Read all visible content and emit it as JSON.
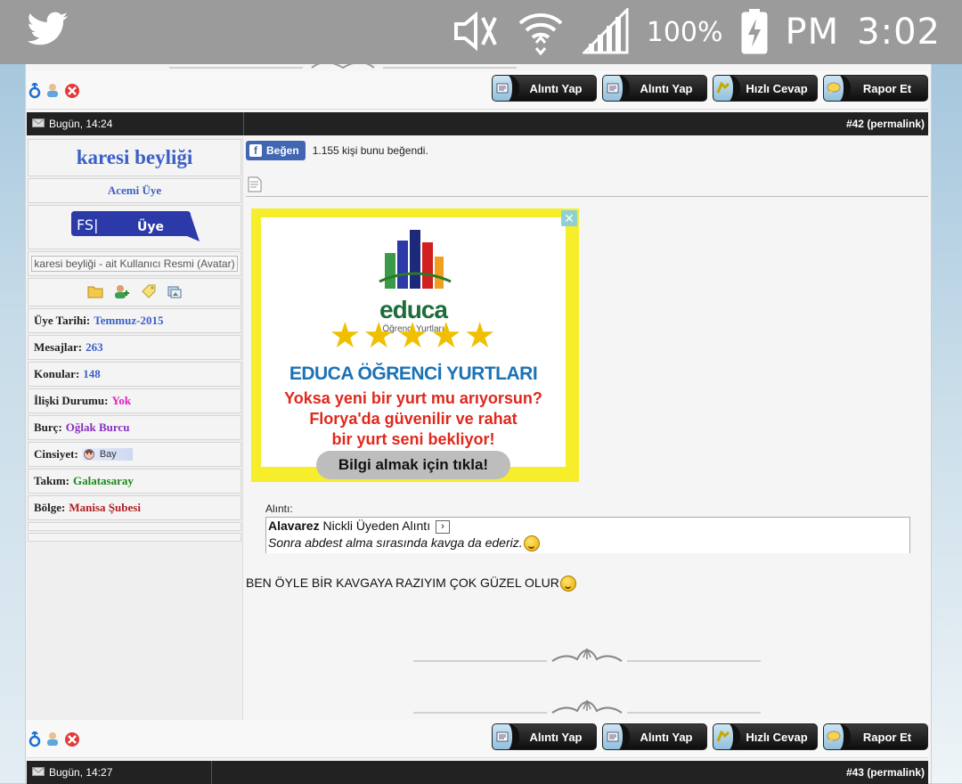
{
  "status_bar": {
    "time": "3:02",
    "ampm": "PM",
    "battery": "100%",
    "icons": [
      "twitter-icon",
      "mute-icon",
      "wifi-icon",
      "signal-icon",
      "battery-charging-icon"
    ]
  },
  "buttons": {
    "quote": "Alıntı Yap",
    "quote_multi": "Alıntı Yap",
    "quick_reply": "Hızlı Cevap",
    "report": "Rapor Et"
  },
  "post": {
    "date": "Bugün, 14:24",
    "number": "#42",
    "permalink": "(permalink)",
    "user": {
      "name": "karesi beyliği",
      "title": "Acemi Üye",
      "rank_badge_text": "FS| Üye",
      "avatar_alt": "karesi beyliği - ait Kullanıcı Resmi (Avatar)",
      "fields": [
        {
          "label": "Üye Tarihi:",
          "value": "Temmuz-2015",
          "color": "#3a5fc8"
        },
        {
          "label": "Mesajlar:",
          "value": "263",
          "color": "#3a5fc8"
        },
        {
          "label": "Konular:",
          "value": "148",
          "color": "#3a5fc8"
        },
        {
          "label": "İlişki Durumu:",
          "value": "Yok",
          "color": "#e020c0"
        },
        {
          "label": "Burç:",
          "value": "Oğlak Burcu",
          "color": "#8a2fc0"
        },
        {
          "label": "Cinsiyet:",
          "value": "Bay",
          "color": "#334"
        },
        {
          "label": "Takım:",
          "value": "Galatasaray",
          "color": "#1a8a1a"
        },
        {
          "label": "Bölge:",
          "value": "Manisa Şubesi",
          "color": "#b02020"
        }
      ]
    },
    "like": {
      "button": "Beğen",
      "count_text": "1.155 kişi bunu beğendi."
    },
    "ad": {
      "brand": "educa",
      "brand_sub": "Öğrenci Yurtları",
      "title": "EDUCA ÖĞRENCİ YURTLARI",
      "line1": "Yoksa yeni bir yurt mu arıyorsun?",
      "line2": "Florya'da güvenilir ve rahat",
      "line3": "bir yurt seni bekliyor!",
      "cta": "Bilgi almak için tıkla!"
    },
    "quote": {
      "label": "Alıntı:",
      "author": "Alavarez",
      "author_suffix": "Nickli Üyeden Alıntı",
      "text": "Sonra abdest alma sırasında kavga da ederiz."
    },
    "reply_text": "BEN ÖYLE BİR KAVGAYA RAZIYIM ÇOK GÜZEL OLUR"
  },
  "next_post": {
    "date": "Bugün, 14:27",
    "number": "#43",
    "permalink": "(permalink)"
  }
}
